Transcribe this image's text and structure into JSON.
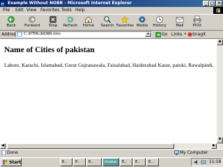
{
  "window": {
    "title": "Example Without NOBR - Microsoft Internet Explorer"
  },
  "menu": {
    "items": [
      "File",
      "Edit",
      "View",
      "Favorites",
      "Tools",
      "Help"
    ]
  },
  "toolbar": {
    "buttons": [
      {
        "label": "Back",
        "icon": "back-arrow-icon"
      },
      {
        "label": "Forward",
        "icon": "forward-arrow-icon"
      },
      {
        "label": "Stop",
        "icon": "stop-icon"
      },
      {
        "label": "Refresh",
        "icon": "refresh-icon"
      },
      {
        "label": "Home",
        "icon": "home-icon"
      },
      {
        "label": "Search",
        "icon": "search-icon"
      },
      {
        "label": "Favorites",
        "icon": "favorites-icon"
      },
      {
        "label": "Media",
        "icon": "media-icon"
      },
      {
        "label": "History",
        "icon": "history-icon"
      },
      {
        "label": "Mail",
        "icon": "mail-icon"
      },
      {
        "label": "Print",
        "icon": "print-icon"
      }
    ]
  },
  "address": {
    "label": "Address",
    "value": "C:\\HTML\\NOBR.htm",
    "go": "Go",
    "links": "Links",
    "snagit": "SnagIt"
  },
  "page": {
    "heading": "Name of Cities of pakistan",
    "cities": "Lahore, Karachi, Islamabad, Gurat Gujranawala, Faisalabad, Haiderabad Kasur, patoki, Rawalpindi,"
  },
  "status": {
    "text": "Done",
    "zone": "My Computer"
  },
  "taskbar": {
    "start": "Start",
    "tasks": [
      "E..",
      "P..",
      "E..",
      "shakal",
      "E..",
      "E..",
      "E.."
    ],
    "clock": "11:18"
  },
  "colors": {
    "title_bar": "#0a246a",
    "task_active": "#5b9ea0"
  }
}
